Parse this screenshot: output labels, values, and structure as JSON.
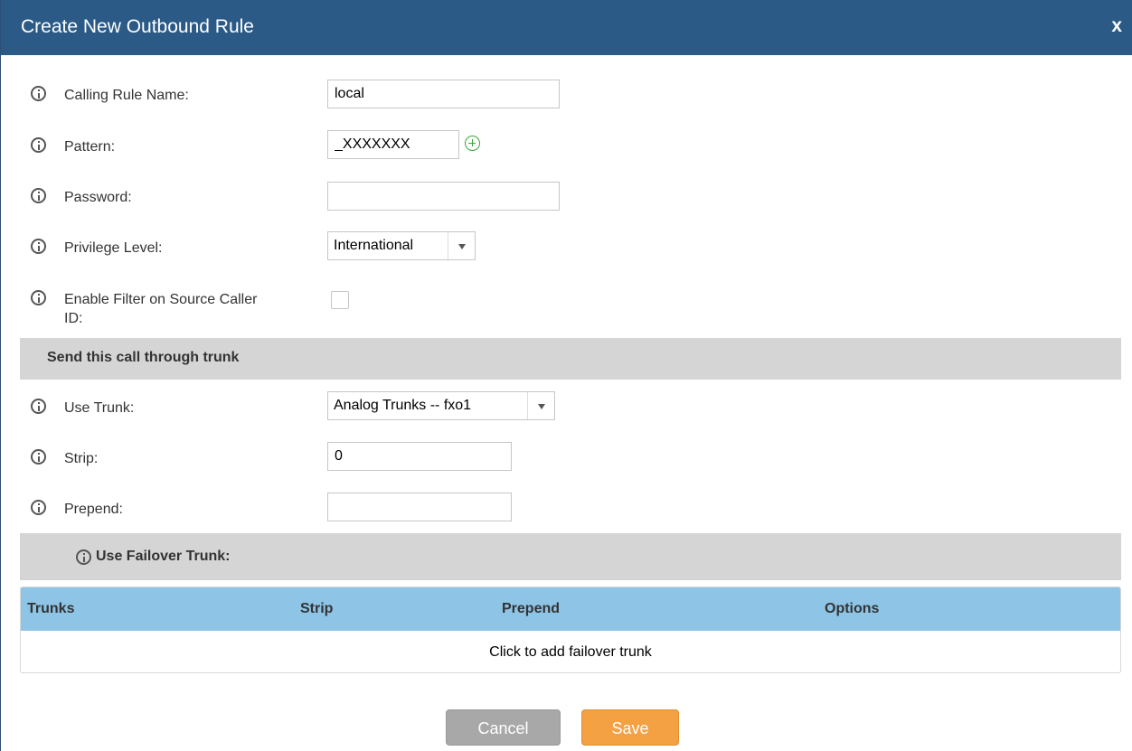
{
  "dialog": {
    "title": "Create New Outbound Rule",
    "close_label": "x"
  },
  "fields": {
    "calling_rule_name": {
      "label": "Calling Rule Name:",
      "value": "local"
    },
    "pattern": {
      "label": "Pattern:",
      "value": "_XXXXXXX"
    },
    "password": {
      "label": "Password:",
      "value": ""
    },
    "privilege_level": {
      "label": "Privilege Level:",
      "value": "International"
    },
    "filter_source_caller_id": {
      "label_line1": "Enable Filter on Source Caller",
      "label_line2": "ID:",
      "checked": false
    }
  },
  "trunk_section": {
    "title": "Send this call through trunk",
    "use_trunk": {
      "label": "Use Trunk:",
      "value": "Analog Trunks -- fxo1"
    },
    "strip": {
      "label": "Strip:",
      "value": "0"
    },
    "prepend": {
      "label": "Prepend:",
      "value": ""
    }
  },
  "failover_section": {
    "title": "Use Failover Trunk:",
    "columns": [
      "Trunks",
      "Strip",
      "Prepend",
      "Options"
    ],
    "empty_row_text": "Click to add failover trunk"
  },
  "buttons": {
    "cancel": "Cancel",
    "save": "Save"
  },
  "colors": {
    "titlebar": "#2b5a86",
    "table_header": "#8ec4e6",
    "section_bg": "#d5d5d5",
    "save_button": "#f3a143",
    "cancel_button": "#a8a8a8",
    "add_icon": "#3aa43a"
  },
  "icons": {
    "info": "info-circle-icon",
    "add_pattern": "plus-circle-icon",
    "dropdown": "triangle-down-icon"
  }
}
